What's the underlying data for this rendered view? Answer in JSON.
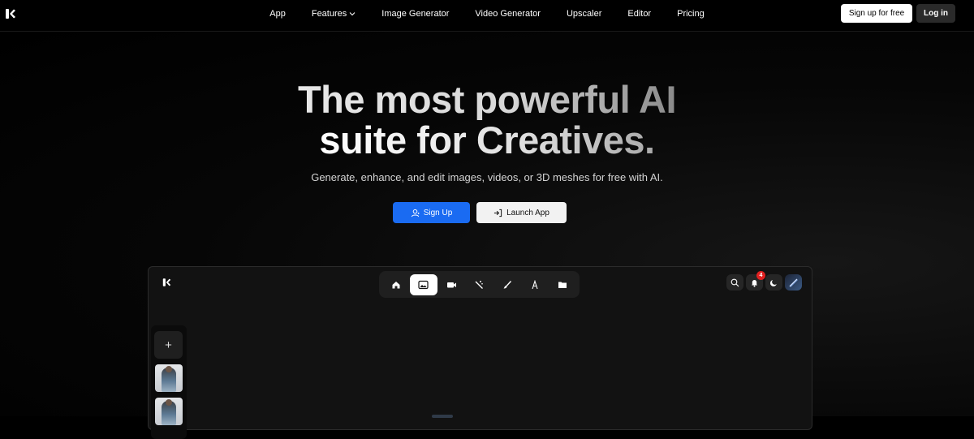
{
  "nav": {
    "logo_icon": "krea-logo-icon",
    "links": [
      "App",
      "Features",
      "Image Generator",
      "Video Generator",
      "Upscaler",
      "Editor",
      "Pricing"
    ],
    "signup_free_label": "Sign up for free",
    "login_label": "Log in"
  },
  "hero": {
    "headline_line1": "The most powerful AI",
    "headline_line2": "suite for Creatives.",
    "subheadline": "Generate, enhance, and edit images, videos, or 3D meshes for free with AI.",
    "primary_cta": "Sign Up",
    "secondary_cta": "Launch App",
    "primary_color": "#1a6bf2"
  },
  "preview": {
    "toolbar_icons": [
      "home-icon",
      "image-icon",
      "video-icon",
      "wand-icon",
      "brush-icon",
      "text-icon",
      "folder-icon"
    ],
    "active_tool": "image-icon",
    "notification_count": "4",
    "sidebar_add_label": "+"
  }
}
